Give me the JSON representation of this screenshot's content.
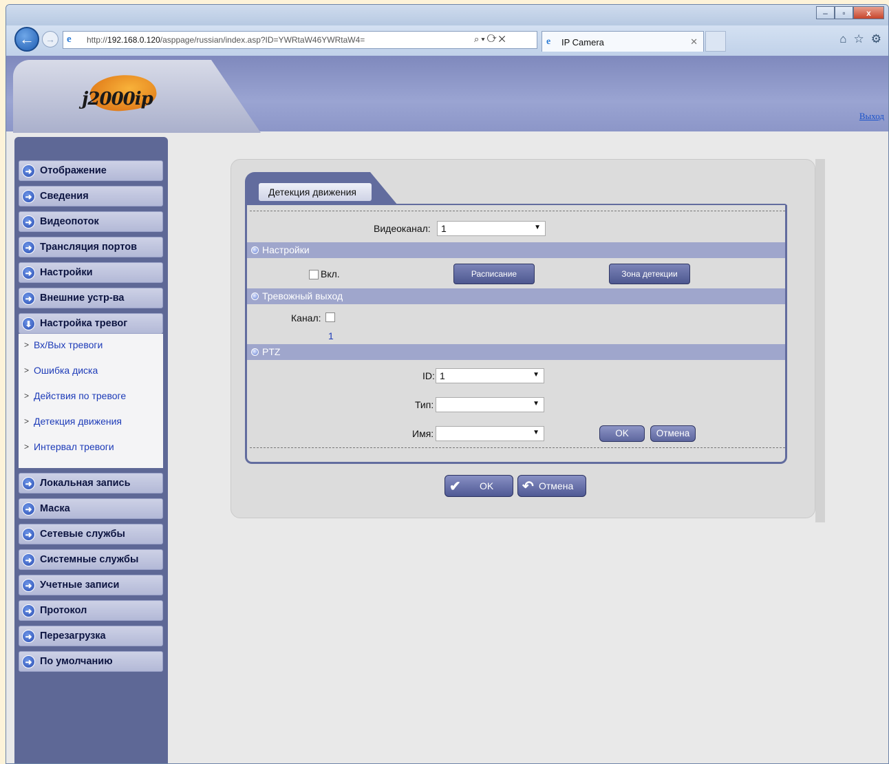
{
  "browser": {
    "url_prefix": "http://",
    "url_host": "192.168.0.120",
    "url_rest": "/asppage/russian/index.asp?ID=YWRtaW46YWRtaW4=",
    "tab_title": "IP Camera",
    "window_minimize": "–",
    "window_maximize": "▫",
    "window_close": "x"
  },
  "header": {
    "logo_text": "j2000ip",
    "logout_link": "Выход"
  },
  "sidebar": {
    "items": [
      {
        "label": "Отображение"
      },
      {
        "label": "Сведения"
      },
      {
        "label": "Видеопоток"
      },
      {
        "label": "Трансляция портов"
      },
      {
        "label": "Настройки"
      },
      {
        "label": "Внешние устр-ва"
      },
      {
        "label": "Настройка тревог"
      },
      {
        "label": "Локальная запись"
      },
      {
        "label": "Маска"
      },
      {
        "label": "Сетевые службы"
      },
      {
        "label": "Системные службы"
      },
      {
        "label": "Учетные записи"
      },
      {
        "label": "Протокол"
      },
      {
        "label": "Перезагрузка"
      },
      {
        "label": "По умолчанию"
      }
    ],
    "submenu": [
      {
        "label": "Вх/Вых тревоги"
      },
      {
        "label": "Ошибка диска"
      },
      {
        "label": "Действия по тревоге"
      },
      {
        "label": "Детекция движения"
      },
      {
        "label": "Интервал тревоги"
      }
    ]
  },
  "main": {
    "tab_label": "Детекция движения",
    "video_channel_label": "Видеоканал:",
    "video_channel_value": "1",
    "settings_section": "Настройки",
    "enable_label": "Вкл.",
    "schedule_button": "Расписание",
    "zone_button": "Зона детекции",
    "alarm_output_section": "Тревожный выход",
    "channel_label": "Канал:",
    "channel_number": "1",
    "ptz_section": "PTZ",
    "id_label": "ID:",
    "id_value": "1",
    "type_label": "Тип:",
    "type_value": "",
    "name_label": "Имя:",
    "name_value": "",
    "ptz_ok": "OK",
    "ptz_cancel": "Отмена",
    "ok_button": "OK",
    "cancel_button": "Отмена"
  }
}
